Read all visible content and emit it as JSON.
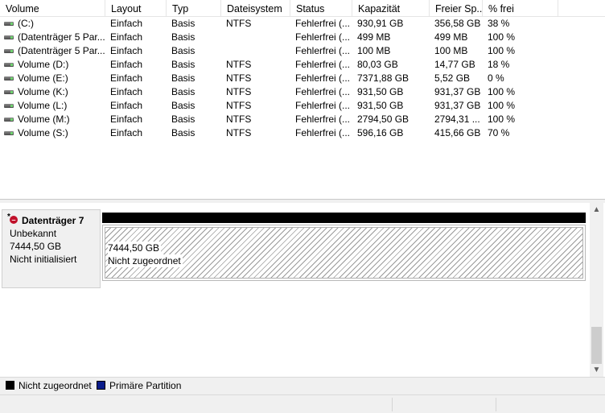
{
  "volume_list": {
    "columns": [
      "Volume",
      "Layout",
      "Typ",
      "Dateisystem",
      "Status",
      "Kapazität",
      "Freier Sp...",
      "% frei"
    ],
    "rows": [
      {
        "volume": "(C:)",
        "layout": "Einfach",
        "typ": "Basis",
        "fs": "NTFS",
        "status": "Fehlerfrei (...",
        "capacity": "930,91 GB",
        "free": "356,58 GB",
        "pct": "38 %"
      },
      {
        "volume": "(Datenträger 5 Par...",
        "layout": "Einfach",
        "typ": "Basis",
        "fs": "",
        "status": "Fehlerfrei (...",
        "capacity": "499 MB",
        "free": "499 MB",
        "pct": "100 %"
      },
      {
        "volume": "(Datenträger 5 Par...",
        "layout": "Einfach",
        "typ": "Basis",
        "fs": "",
        "status": "Fehlerfrei (...",
        "capacity": "100 MB",
        "free": "100 MB",
        "pct": "100 %"
      },
      {
        "volume": "Volume (D:)",
        "layout": "Einfach",
        "typ": "Basis",
        "fs": "NTFS",
        "status": "Fehlerfrei (...",
        "capacity": "80,03 GB",
        "free": "14,77 GB",
        "pct": "18 %"
      },
      {
        "volume": "Volume (E:)",
        "layout": "Einfach",
        "typ": "Basis",
        "fs": "NTFS",
        "status": "Fehlerfrei (...",
        "capacity": "7371,88 GB",
        "free": "5,52 GB",
        "pct": "0 %"
      },
      {
        "volume": "Volume (K:)",
        "layout": "Einfach",
        "typ": "Basis",
        "fs": "NTFS",
        "status": "Fehlerfrei (...",
        "capacity": "931,50 GB",
        "free": "931,37 GB",
        "pct": "100 %"
      },
      {
        "volume": "Volume (L:)",
        "layout": "Einfach",
        "typ": "Basis",
        "fs": "NTFS",
        "status": "Fehlerfrei (...",
        "capacity": "931,50 GB",
        "free": "931,37 GB",
        "pct": "100 %"
      },
      {
        "volume": "Volume (M:)",
        "layout": "Einfach",
        "typ": "Basis",
        "fs": "NTFS",
        "status": "Fehlerfrei (...",
        "capacity": "2794,50 GB",
        "free": "2794,31 ...",
        "pct": "100 %"
      },
      {
        "volume": "Volume (S:)",
        "layout": "Einfach",
        "typ": "Basis",
        "fs": "NTFS",
        "status": "Fehlerfrei (...",
        "capacity": "596,16 GB",
        "free": "415,66 GB",
        "pct": "70 %"
      }
    ]
  },
  "disk": {
    "icon": "disk-error-icon",
    "title": "Datenträger 7",
    "type": "Unbekannt",
    "size": "7444,50 GB",
    "state": "Nicht initialisiert",
    "partition": {
      "size": "7444,50 GB",
      "label": "Nicht zugeordnet"
    }
  },
  "scrollbar": {
    "up": "▲",
    "down": "▼"
  },
  "legend": [
    {
      "label": "Nicht zugeordnet",
      "color": "#000000"
    },
    {
      "label": "Primäre Partition",
      "color": "#0a1c8a"
    }
  ]
}
